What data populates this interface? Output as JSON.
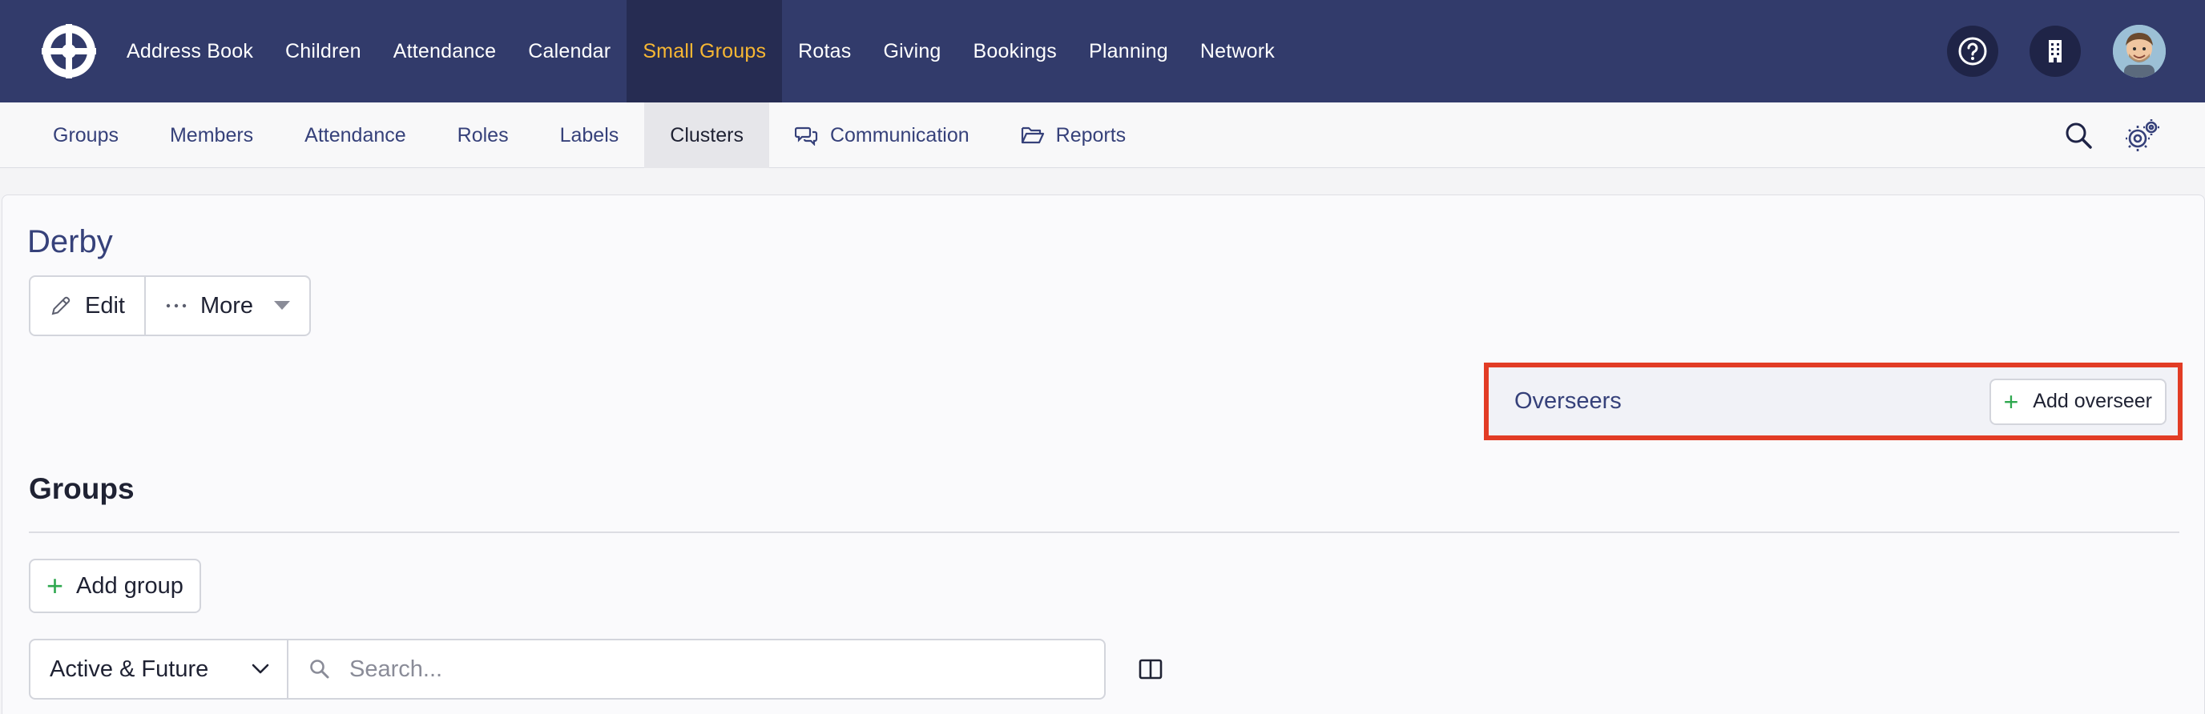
{
  "topnav": {
    "logo_icon": "wheel-logo-icon",
    "items": [
      {
        "label": "Address Book"
      },
      {
        "label": "Children"
      },
      {
        "label": "Attendance"
      },
      {
        "label": "Calendar"
      },
      {
        "label": "Small Groups",
        "active": true
      },
      {
        "label": "Rotas"
      },
      {
        "label": "Giving"
      },
      {
        "label": "Bookings"
      },
      {
        "label": "Planning"
      },
      {
        "label": "Network"
      }
    ],
    "right_icons": [
      "help-icon",
      "building-icon",
      "user-avatar"
    ],
    "active_color": "#f7b733",
    "bar_color": "#323b6b"
  },
  "subnav": {
    "items": [
      {
        "label": "Groups"
      },
      {
        "label": "Members"
      },
      {
        "label": "Attendance"
      },
      {
        "label": "Roles"
      },
      {
        "label": "Labels"
      },
      {
        "label": "Clusters",
        "active": true
      },
      {
        "label": "Communication",
        "icon": "chat-bubbles-icon"
      },
      {
        "label": "Reports",
        "icon": "folder-open-icon"
      }
    ],
    "right_icons": [
      "search-icon",
      "settings-gears-icon"
    ]
  },
  "page": {
    "title": "Derby",
    "edit_label": "Edit",
    "more_label": "More"
  },
  "overseers": {
    "label": "Overseers",
    "add_label": "Add overseer"
  },
  "groups": {
    "title": "Groups",
    "add_label": "Add group",
    "status_filter": "Active & Future",
    "search_placeholder": "Search..."
  }
}
